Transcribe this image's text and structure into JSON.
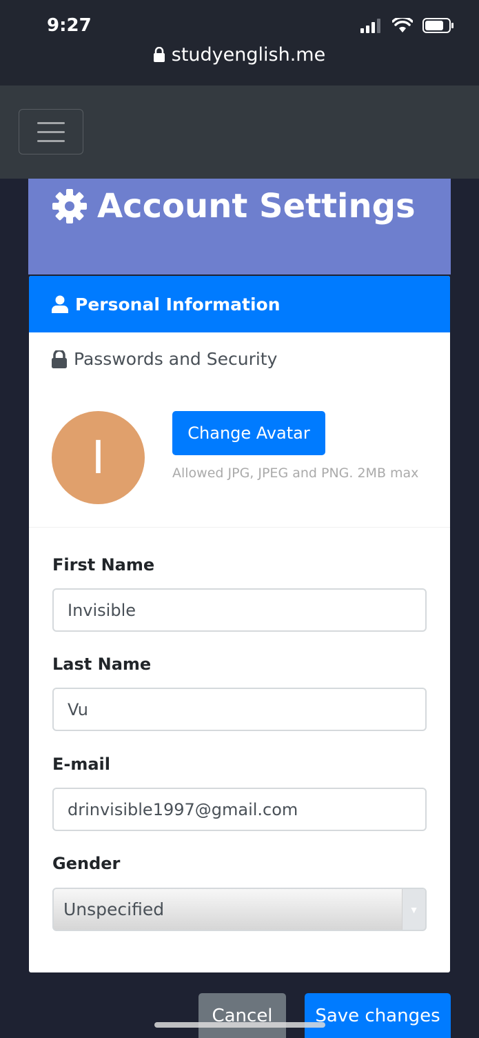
{
  "status_bar": {
    "time": "9:27",
    "url": "studyenglish.me"
  },
  "page": {
    "title": "Account Settings"
  },
  "tabs": {
    "personal": "Personal Information",
    "security": "Passwords and Security"
  },
  "avatar": {
    "initial": "I",
    "color": "#e0a06c",
    "change_label": "Change Avatar",
    "help": "Allowed JPG, JPEG and PNG. 2MB max"
  },
  "form": {
    "first_name": {
      "label": "First Name",
      "value": "Invisible"
    },
    "last_name": {
      "label": "Last Name",
      "value": "Vu"
    },
    "email": {
      "label": "E-mail",
      "value": "drinvisible1997@gmail.com"
    },
    "gender": {
      "label": "Gender",
      "value": "Unspecified"
    }
  },
  "actions": {
    "cancel": "Cancel",
    "save": "Save changes"
  },
  "colors": {
    "primary": "#007bff",
    "banner": "#6e7fce",
    "navbar": "#343a40",
    "secondary": "#6c757d"
  }
}
